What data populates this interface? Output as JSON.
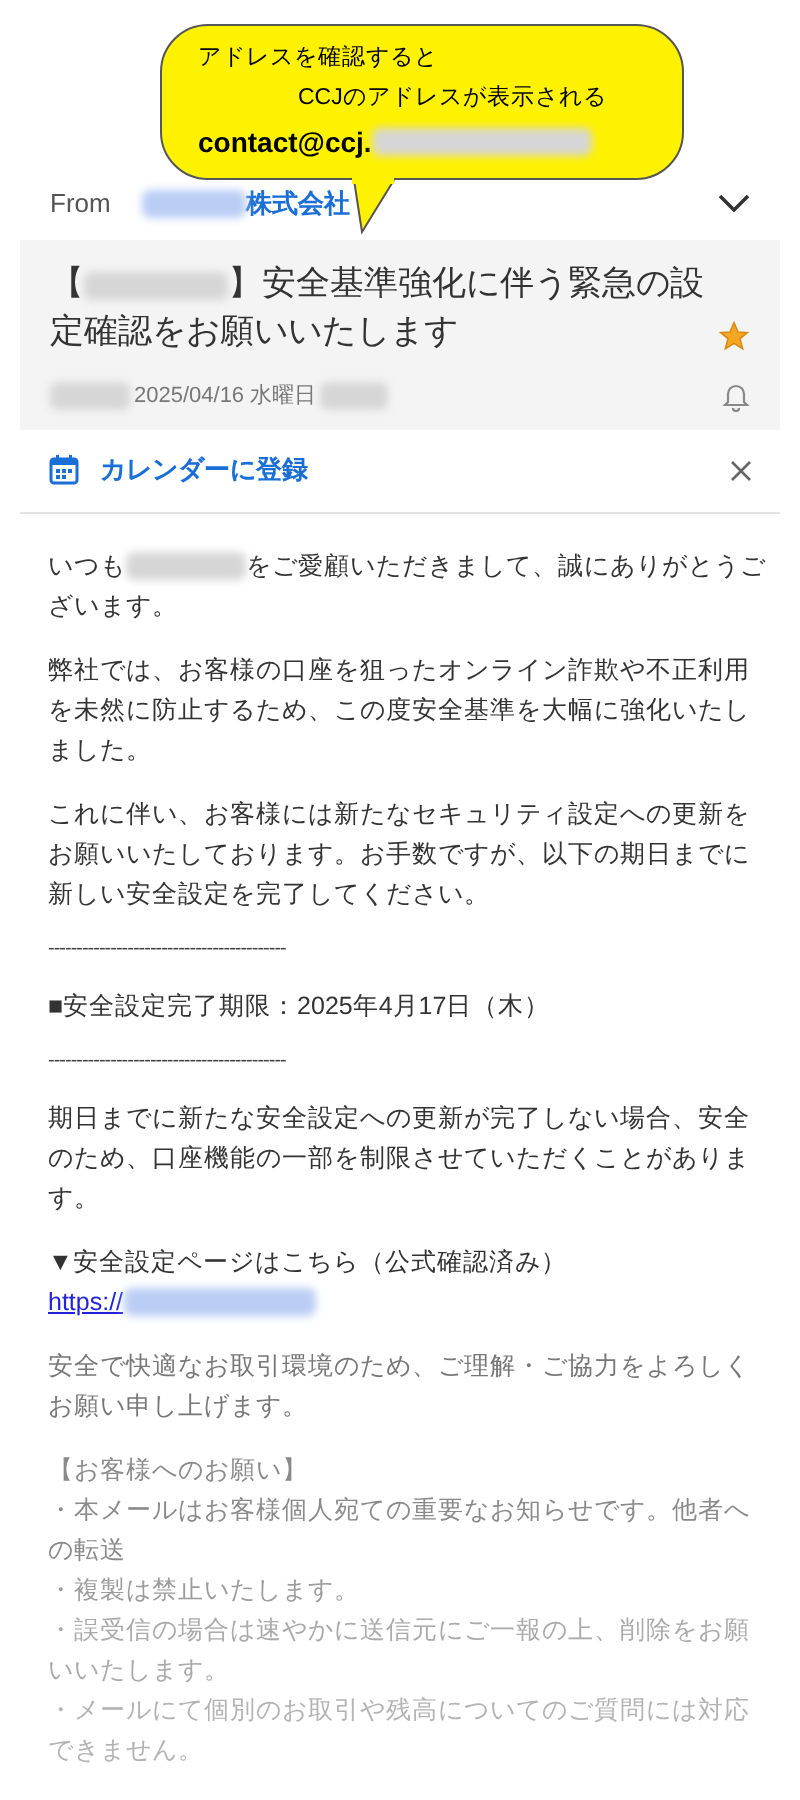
{
  "callout": {
    "lines": [
      {
        "kind": "text",
        "text": "アドレスを確認すると"
      },
      {
        "kind": "indented",
        "text": "CCJのアドレスが表示される"
      },
      {
        "kind": "address",
        "text": "contact@ccj."
      }
    ]
  },
  "header": {
    "from_label": "From",
    "sender": "株式会社"
  },
  "subject": {
    "prefix": "【",
    "title": "】安全基準強化に伴う緊急の設定確認をお願いいたします",
    "starred": true,
    "date": "2025/04/16 水曜日"
  },
  "calendar_bar": {
    "label": "カレンダーに登録"
  },
  "body": [
    {
      "kind": "paragraph",
      "color": "#333333",
      "parts": [
        {
          "kind": "text",
          "text": "いつも"
        },
        {
          "kind": "redacted"
        },
        {
          "kind": "text",
          "text": "をご愛顧いただきまして、誠にありがとうございます。"
        }
      ]
    },
    {
      "kind": "paragraph",
      "color": "#333333",
      "parts": [
        {
          "kind": "text",
          "text": "弊社では、お客様の口座を狙ったオンライン詐欺や不正利用を未然に防止するため、この度安全基準を大幅に強化いたしました。"
        }
      ]
    },
    {
      "kind": "paragraph",
      "color": "#333333",
      "parts": [
        {
          "kind": "text",
          "text": "これに伴い、お客様には新たなセキュリティ設定への更新をお願いいたしております。お手数ですが、以下の期日までに新しい安全設定を完了してください。"
        }
      ]
    },
    {
      "kind": "rule",
      "text": "------------------------------------------"
    },
    {
      "kind": "paragraph",
      "color": "#333333",
      "parts": [
        {
          "kind": "text",
          "text": "■安全設定完了期限：2025年4月17日（木）"
        }
      ]
    },
    {
      "kind": "rule",
      "text": "------------------------------------------"
    },
    {
      "kind": "paragraph",
      "color": "#333333",
      "parts": [
        {
          "kind": "text",
          "text": "期日までに新たな安全設定への更新が完了しない場合、安全のため、口座機能の一部を制限させていただくことがあります。"
        }
      ]
    },
    {
      "kind": "link",
      "heading": "▼安全設定ページはこちら（公式確認済み）",
      "url": "https://"
    },
    {
      "kind": "paragraph",
      "color": "#777777",
      "parts": [
        {
          "kind": "text",
          "text": "安全で快適なお取引環境のため、ご理解・ご協力をよろしくお願い申し上げます。"
        }
      ]
    },
    {
      "kind": "notice",
      "lines": [
        {
          "text": "【お客様へのお願い】",
          "color": "#8a8a8a"
        },
        {
          "text": "・本メールはお客様個人宛ての重要なお知らせです。他者への転送",
          "color": "#8a8a8a"
        },
        {
          "text": "・複製は禁止いたします。",
          "color": "#9c9c9c"
        },
        {
          "text": "・誤受信の場合は速やかに送信元にご一報の上、削除をお願いいたします。",
          "color": "#aaaaaa"
        },
        {
          "text": "・メールにて個別のお取引や残高についてのご質問には対応できません。",
          "color": "#b3b3b3"
        }
      ]
    }
  ]
}
